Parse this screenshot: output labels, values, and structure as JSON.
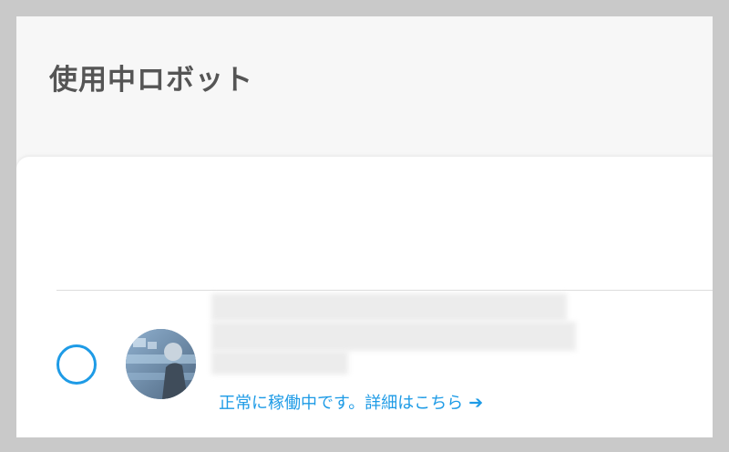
{
  "header": {
    "title": "使用中ロボット"
  },
  "robot": {
    "status_text": "正常に稼働中です。",
    "details_link": "詳細はこちら",
    "arrow_icon": "arrow-right-icon",
    "avatar_icon": "robot-avatar-icon"
  },
  "colors": {
    "accent": "#1e9be6",
    "title": "#555555"
  }
}
